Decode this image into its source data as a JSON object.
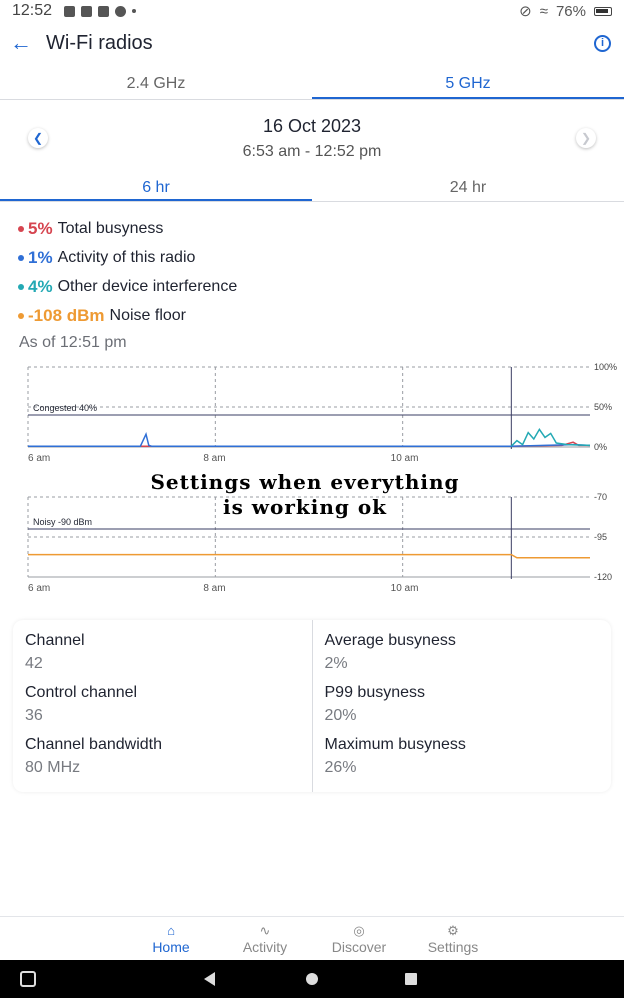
{
  "status_bar": {
    "time": "12:52",
    "battery": "76%"
  },
  "header": {
    "title": "Wi-Fi radios",
    "back_icon": "arrow-left-icon",
    "info_icon": "info-icon"
  },
  "band_tabs": [
    {
      "label": "2.4 GHz",
      "active": false
    },
    {
      "label": "5 GHz",
      "active": true
    }
  ],
  "date_nav": {
    "date": "16 Oct 2023",
    "range": "6:53 am - 12:52 pm",
    "prev_icon": "chevron-left-icon",
    "next_icon": "chevron-right-icon"
  },
  "range_tabs": [
    {
      "label": "6 hr",
      "active": true
    },
    {
      "label": "24 hr",
      "active": false
    }
  ],
  "stats": [
    {
      "value": "5%",
      "label": "Total busyness",
      "color": "#d64550"
    },
    {
      "value": "1%",
      "label": "Activity of this radio",
      "color": "#2f6fd6"
    },
    {
      "value": "4%",
      "label": "Other device interference",
      "color": "#23a9b4"
    },
    {
      "value": "-108 dBm",
      "label": "Noise floor",
      "color": "#ee9a33"
    }
  ],
  "as_of": "As of 12:51 pm",
  "overlay_note": {
    "line1": "Settings when everything",
    "line2": "is working ok"
  },
  "chart_data": [
    {
      "type": "line",
      "name": "busyness",
      "x_ticks": [
        "6 am",
        "8 am",
        "10 am"
      ],
      "y_ticks": [
        "100%",
        "50%",
        "0%"
      ],
      "ylim": [
        0,
        100
      ],
      "threshold": {
        "label": "Congested 40%",
        "value": 40
      },
      "series": [
        {
          "name": "Total busyness",
          "color": "#d64550",
          "points": [
            [
              0,
              1
            ],
            [
              0.5,
              1
            ],
            [
              0.6,
              1
            ],
            [
              0.86,
              1
            ],
            [
              0.95,
              2
            ],
            [
              0.97,
              6
            ],
            [
              0.98,
              2
            ],
            [
              1.0,
              2
            ]
          ]
        },
        {
          "name": "Activity of this radio",
          "color": "#2f6fd6",
          "points": [
            [
              0,
              1
            ],
            [
              0.2,
              1
            ],
            [
              0.21,
              16
            ],
            [
              0.215,
              2
            ],
            [
              0.22,
              1
            ],
            [
              0.86,
              1
            ],
            [
              0.97,
              3
            ],
            [
              1.0,
              2
            ]
          ]
        },
        {
          "name": "Other device interference",
          "color": "#23a9b4",
          "points": [
            [
              0.86,
              1
            ],
            [
              0.87,
              8
            ],
            [
              0.88,
              3
            ],
            [
              0.89,
              18
            ],
            [
              0.9,
              10
            ],
            [
              0.91,
              22
            ],
            [
              0.92,
              12
            ],
            [
              0.93,
              17
            ],
            [
              0.94,
              5
            ],
            [
              0.96,
              3
            ],
            [
              1.0,
              2
            ]
          ]
        }
      ]
    },
    {
      "type": "line",
      "name": "noise",
      "x_ticks": [
        "6 am",
        "8 am",
        "10 am"
      ],
      "y_ticks": [
        "-70",
        "-95",
        "-120"
      ],
      "ylim": [
        -120,
        -70
      ],
      "threshold": {
        "label": "Noisy -90 dBm",
        "value": -90
      },
      "series": [
        {
          "name": "Noise floor",
          "color": "#ee9a33",
          "points": [
            [
              0,
              -106
            ],
            [
              0.86,
              -106
            ],
            [
              0.87,
              -108
            ],
            [
              1.0,
              -108
            ]
          ]
        }
      ]
    }
  ],
  "details": {
    "left": [
      {
        "label": "Channel",
        "value": "42"
      },
      {
        "label": "Control channel",
        "value": "36"
      },
      {
        "label": "Channel bandwidth",
        "value": "80 MHz"
      }
    ],
    "right": [
      {
        "label": "Average busyness",
        "value": "2%"
      },
      {
        "label": "P99 busyness",
        "value": "20%"
      },
      {
        "label": "Maximum busyness",
        "value": "26%"
      }
    ]
  },
  "bottom_nav": [
    {
      "label": "Home",
      "icon": "home-icon",
      "active": true
    },
    {
      "label": "Activity",
      "icon": "activity-icon",
      "active": false
    },
    {
      "label": "Discover",
      "icon": "compass-icon",
      "active": false
    },
    {
      "label": "Settings",
      "icon": "gear-icon",
      "active": false
    }
  ]
}
